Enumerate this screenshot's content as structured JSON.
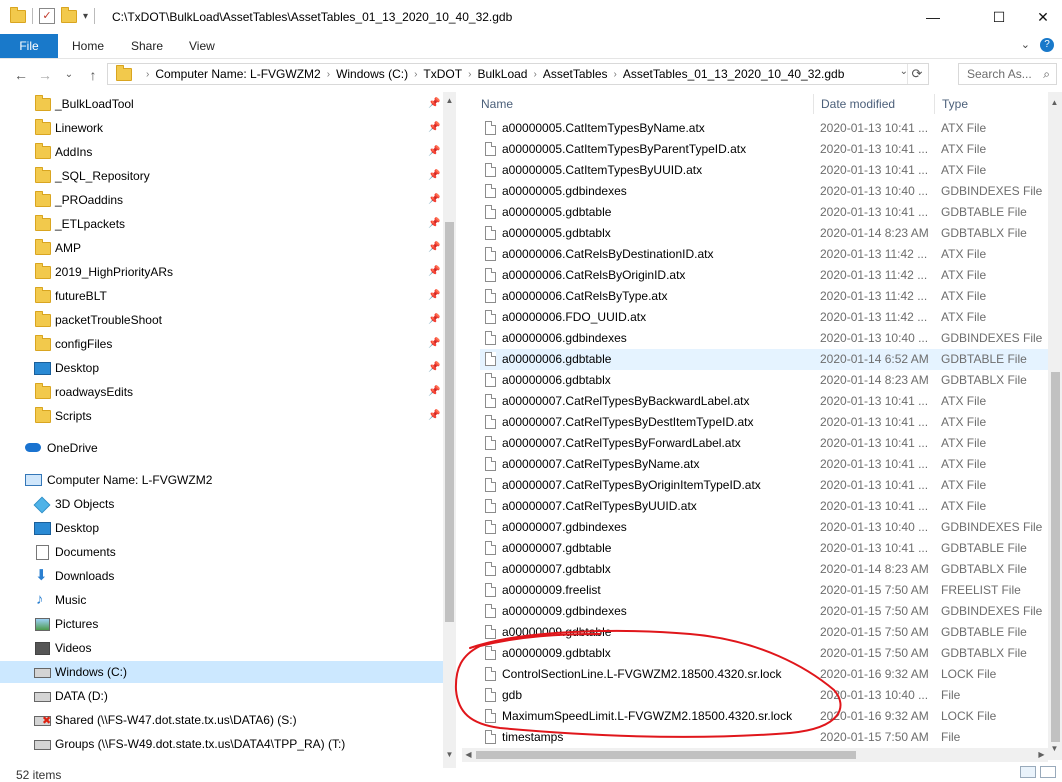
{
  "window": {
    "title": "C:\\TxDOT\\BulkLoad\\AssetTables\\AssetTables_01_13_2020_10_40_32.gdb",
    "minimize": "—",
    "maximize": "☐",
    "close": "✕"
  },
  "ribbon": {
    "tabs": [
      "File",
      "Home",
      "Share",
      "View"
    ],
    "expand": "⌄",
    "help": "?"
  },
  "address": {
    "back": "←",
    "forward": "→",
    "recent": "⌄",
    "up": "↑",
    "crumbs": [
      "Computer Name:  L-FVGWZM2",
      "Windows (C:)",
      "TxDOT",
      "BulkLoad",
      "AssetTables",
      "AssetTables_01_13_2020_10_40_32.gdb"
    ],
    "search_placeholder": "Search As..."
  },
  "nav": {
    "quick_access": [
      {
        "label": "_BulkLoadTool",
        "icon": "folder-icon"
      },
      {
        "label": "Linework",
        "icon": "folder-icon"
      },
      {
        "label": "AddIns",
        "icon": "folder-icon"
      },
      {
        "label": "_SQL_Repository",
        "icon": "folder-icon"
      },
      {
        "label": "_PROaddins",
        "icon": "folder-icon"
      },
      {
        "label": "_ETLpackets",
        "icon": "folder-icon"
      },
      {
        "label": "AMP",
        "icon": "folder-icon"
      },
      {
        "label": "2019_HighPriorityARs",
        "icon": "folder-icon"
      },
      {
        "label": "futureBLT",
        "icon": "folder-icon"
      },
      {
        "label": "packetTroubleShoot",
        "icon": "folder-icon"
      },
      {
        "label": "configFiles",
        "icon": "folder-icon"
      },
      {
        "label": "Desktop",
        "icon": "desktop-icon"
      },
      {
        "label": "roadwaysEdits",
        "icon": "folder-icon"
      },
      {
        "label": "Scripts",
        "icon": "folder-icon"
      }
    ],
    "onedrive": "OneDrive",
    "computer": "Computer Name:  L-FVGWZM2",
    "computer_items": [
      {
        "label": "3D Objects",
        "icon": "cube-icon"
      },
      {
        "label": "Desktop",
        "icon": "desktop-icon"
      },
      {
        "label": "Documents",
        "icon": "document-icon"
      },
      {
        "label": "Downloads",
        "icon": "download-icon"
      },
      {
        "label": "Music",
        "icon": "music-icon"
      },
      {
        "label": "Pictures",
        "icon": "picture-icon"
      },
      {
        "label": "Videos",
        "icon": "video-icon"
      },
      {
        "label": "Windows (C:)",
        "icon": "drive-icon"
      },
      {
        "label": "DATA (D:)",
        "icon": "drive-icon"
      },
      {
        "label": "Shared (\\\\FS-W47.dot.state.tx.us\\DATA6) (S:)",
        "icon": "network-drive-icon"
      },
      {
        "label": "Groups (\\\\FS-W49.dot.state.tx.us\\DATA4\\TPP_RA) (T:)",
        "icon": "network-drive-icon"
      }
    ]
  },
  "columns": {
    "name": "Name",
    "date": "Date modified",
    "type": "Type"
  },
  "files": [
    {
      "name": "a00000005.CatItemTypesByName.atx",
      "date": "2020-01-13 10:41 ...",
      "type": "ATX File"
    },
    {
      "name": "a00000005.CatItemTypesByParentTypeID.atx",
      "date": "2020-01-13 10:41 ...",
      "type": "ATX File"
    },
    {
      "name": "a00000005.CatItemTypesByUUID.atx",
      "date": "2020-01-13 10:41 ...",
      "type": "ATX File"
    },
    {
      "name": "a00000005.gdbindexes",
      "date": "2020-01-13 10:40 ...",
      "type": "GDBINDEXES File"
    },
    {
      "name": "a00000005.gdbtable",
      "date": "2020-01-13 10:41 ...",
      "type": "GDBTABLE File"
    },
    {
      "name": "a00000005.gdbtablx",
      "date": "2020-01-14 8:23 AM",
      "type": "GDBTABLX File"
    },
    {
      "name": "a00000006.CatRelsByDestinationID.atx",
      "date": "2020-01-13 11:42 ...",
      "type": "ATX File"
    },
    {
      "name": "a00000006.CatRelsByOriginID.atx",
      "date": "2020-01-13 11:42 ...",
      "type": "ATX File"
    },
    {
      "name": "a00000006.CatRelsByType.atx",
      "date": "2020-01-13 11:42 ...",
      "type": "ATX File"
    },
    {
      "name": "a00000006.FDO_UUID.atx",
      "date": "2020-01-13 11:42 ...",
      "type": "ATX File"
    },
    {
      "name": "a00000006.gdbindexes",
      "date": "2020-01-13 10:40 ...",
      "type": "GDBINDEXES File"
    },
    {
      "name": "a00000006.gdbtable",
      "date": "2020-01-14 6:52 AM",
      "type": "GDBTABLE File"
    },
    {
      "name": "a00000006.gdbtablx",
      "date": "2020-01-14 8:23 AM",
      "type": "GDBTABLX File"
    },
    {
      "name": "a00000007.CatRelTypesByBackwardLabel.atx",
      "date": "2020-01-13 10:41 ...",
      "type": "ATX File"
    },
    {
      "name": "a00000007.CatRelTypesByDestItemTypeID.atx",
      "date": "2020-01-13 10:41 ...",
      "type": "ATX File"
    },
    {
      "name": "a00000007.CatRelTypesByForwardLabel.atx",
      "date": "2020-01-13 10:41 ...",
      "type": "ATX File"
    },
    {
      "name": "a00000007.CatRelTypesByName.atx",
      "date": "2020-01-13 10:41 ...",
      "type": "ATX File"
    },
    {
      "name": "a00000007.CatRelTypesByOriginItemTypeID.atx",
      "date": "2020-01-13 10:41 ...",
      "type": "ATX File"
    },
    {
      "name": "a00000007.CatRelTypesByUUID.atx",
      "date": "2020-01-13 10:41 ...",
      "type": "ATX File"
    },
    {
      "name": "a00000007.gdbindexes",
      "date": "2020-01-13 10:40 ...",
      "type": "GDBINDEXES File"
    },
    {
      "name": "a00000007.gdbtable",
      "date": "2020-01-13 10:41 ...",
      "type": "GDBTABLE File"
    },
    {
      "name": "a00000007.gdbtablx",
      "date": "2020-01-14 8:23 AM",
      "type": "GDBTABLX File"
    },
    {
      "name": "a00000009.freelist",
      "date": "2020-01-15 7:50 AM",
      "type": "FREELIST File"
    },
    {
      "name": "a00000009.gdbindexes",
      "date": "2020-01-15 7:50 AM",
      "type": "GDBINDEXES File"
    },
    {
      "name": "a00000009.gdbtable",
      "date": "2020-01-15 7:50 AM",
      "type": "GDBTABLE File"
    },
    {
      "name": "a00000009.gdbtablx",
      "date": "2020-01-15 7:50 AM",
      "type": "GDBTABLX File"
    },
    {
      "name": "ControlSectionLine.L-FVGWZM2.18500.4320.sr.lock",
      "date": "2020-01-16 9:32 AM",
      "type": "LOCK File"
    },
    {
      "name": "gdb",
      "date": "2020-01-13 10:40 ...",
      "type": "File"
    },
    {
      "name": "MaximumSpeedLimit.L-FVGWZM2.18500.4320.sr.lock",
      "date": "2020-01-16 9:32 AM",
      "type": "LOCK File"
    },
    {
      "name": "timestamps",
      "date": "2020-01-15 7:50 AM",
      "type": "File"
    }
  ],
  "status": {
    "count": "52 items"
  },
  "colors": {
    "accent": "#1979ca",
    "selection": "#cce8ff",
    "hover": "#e5f3ff",
    "ink": "#e0161b"
  }
}
